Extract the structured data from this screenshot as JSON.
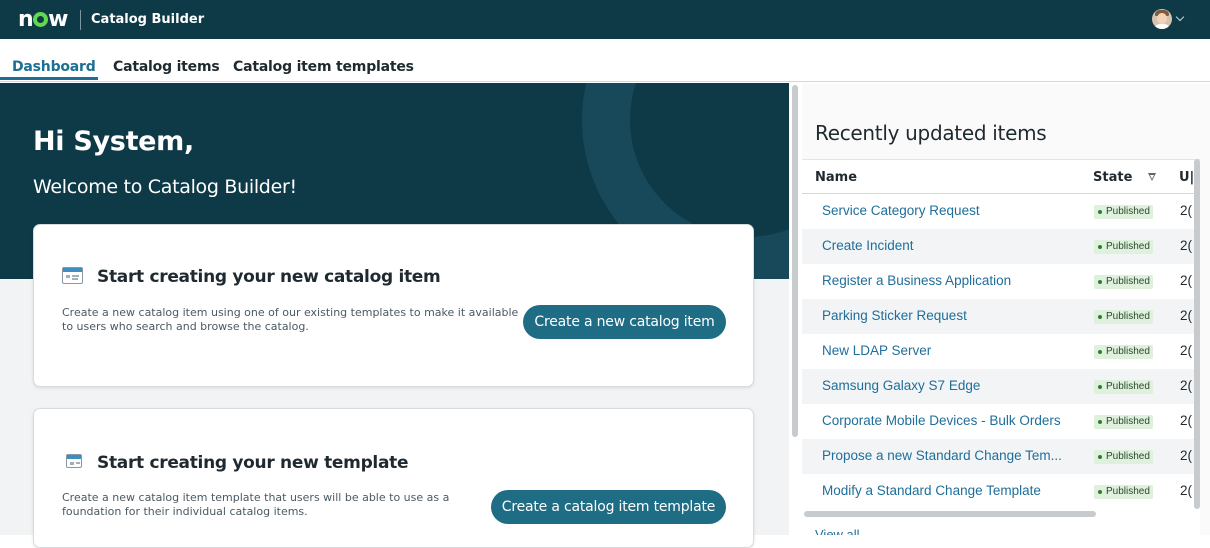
{
  "header": {
    "logo": "now",
    "app_title": "Catalog Builder",
    "avatar_icon": "user-avatar",
    "menu_icon": "chevron-down-icon"
  },
  "tabs": [
    {
      "label": "Dashboard",
      "active": true
    },
    {
      "label": "Catalog items",
      "active": false
    },
    {
      "label": "Catalog item templates",
      "active": false
    }
  ],
  "hero": {
    "greeting": "Hi System,",
    "welcome": "Welcome to Catalog Builder!"
  },
  "cards": [
    {
      "title": "Start creating your new catalog item",
      "description": "Create a new catalog item using one of our existing templates to make it available to users who search and browse the catalog.",
      "button": "Create a new catalog item",
      "icon": "catalog-item-icon"
    },
    {
      "title": "Start creating your new template",
      "description": "Create a new catalog item template that users will be able to use as a foundation for their individual catalog items.",
      "button": "Create a catalog item template",
      "icon": "template-icon"
    }
  ],
  "recent": {
    "title": "Recently updated items",
    "columns": {
      "name": "Name",
      "state": "State",
      "updated": "U|"
    },
    "rows": [
      {
        "name": "Service Category Request",
        "state": "Published",
        "updated": "2("
      },
      {
        "name": "Create Incident",
        "state": "Published",
        "updated": "2("
      },
      {
        "name": "Register a Business Application",
        "state": "Published",
        "updated": "2("
      },
      {
        "name": "Parking Sticker Request",
        "state": "Published",
        "updated": "2("
      },
      {
        "name": "New LDAP Server",
        "state": "Published",
        "updated": "2("
      },
      {
        "name": "Samsung Galaxy S7 Edge",
        "state": "Published",
        "updated": "2("
      },
      {
        "name": "Corporate Mobile Devices - Bulk Orders",
        "state": "Published",
        "updated": "2("
      },
      {
        "name": "Propose a new Standard Change Tem...",
        "state": "Published",
        "updated": "2("
      },
      {
        "name": "Modify a Standard Change Template",
        "state": "Published",
        "updated": "2("
      }
    ],
    "view_all": "View all"
  },
  "colors": {
    "header_bg": "#0e3a48",
    "accent": "#1d6f93",
    "button": "#1e6d85",
    "published_badge": "#dff0dc",
    "logo_ring": "#62d84e"
  }
}
